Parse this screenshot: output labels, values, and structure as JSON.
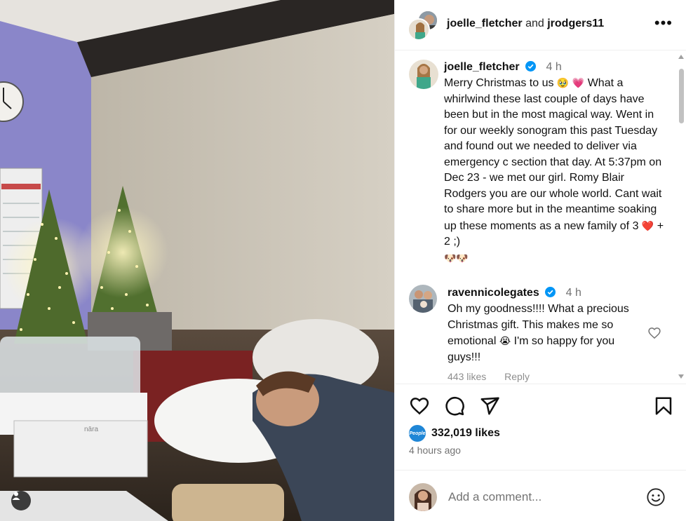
{
  "header": {
    "user1": "joelle_fletcher",
    "conjunction": "and",
    "user2": "jrodgers11",
    "more": "•••"
  },
  "caption": {
    "username": "joelle_fletcher",
    "time": "4 h",
    "text_part1": "Merry Christmas to us ",
    "emoji1": "🥹",
    "emoji2": "💗",
    "text_part2": " What a whirlwind these last couple of days have been but in the most magical way. Went in for our weekly sonogram this past Tuesday and found out we needed to deliver via emergency c section that day. At 5:37pm on Dec 23 - we met our girl. Romy Blair Rodgers you are our whole world. Cant wait to share more but in the meantime soaking up these moments as a new family of 3 ",
    "emoji3": "❤️",
    "text_part3": " + 2 ;)",
    "emoji4": "🐶🐶"
  },
  "comment": {
    "username": "ravennicolegates",
    "time": "4 h",
    "text_part1": "Oh my goodness!!!! What a precious Christmas gift. This makes me so emotional ",
    "emoji": "😭",
    "text_part2": " I'm so happy for you guys!!!",
    "likes": "443 likes",
    "reply": "Reply"
  },
  "stats": {
    "likes": "332,019 likes",
    "liked_by_badge": "People",
    "time_ago": "4 hours ago"
  },
  "compose": {
    "placeholder": "Add a comment..."
  },
  "colors": {
    "verified": "#0095f6",
    "wall": "#8a86c9",
    "text": "#262626",
    "muted": "#737373"
  },
  "icons": [
    "user-tag-icon",
    "more-icon",
    "verified-icon",
    "heart-icon",
    "comment-icon",
    "share-icon",
    "bookmark-icon",
    "emoji-icon"
  ]
}
